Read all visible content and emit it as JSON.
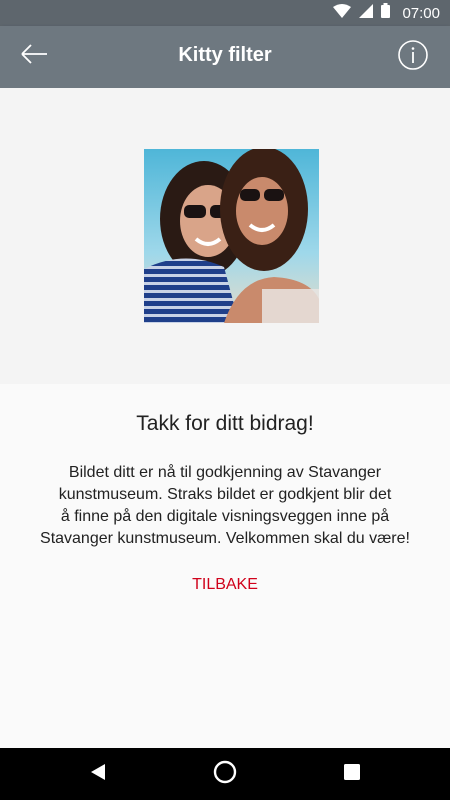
{
  "status_bar": {
    "time": "07:00"
  },
  "toolbar": {
    "title": "Kitty filter",
    "back_icon": "arrow-left-icon",
    "info_icon": "info-icon"
  },
  "photo": {
    "description_icon": "filtered-selfie-photo"
  },
  "message": {
    "heading": "Takk for ditt bidrag!",
    "body": "Bildet ditt er nå til godkjenning av Stavanger\nkunstmuseum. Straks bildet er godkjent blir det\nå finne på den digitale visningsveggen inne på\nStavanger kunstmuseum. Velkommen skal du være!",
    "back_label": "TILBAKE"
  },
  "colors": {
    "toolbar": "#6e7880",
    "status_bar": "#5e666d",
    "accent": "#d0021b"
  }
}
